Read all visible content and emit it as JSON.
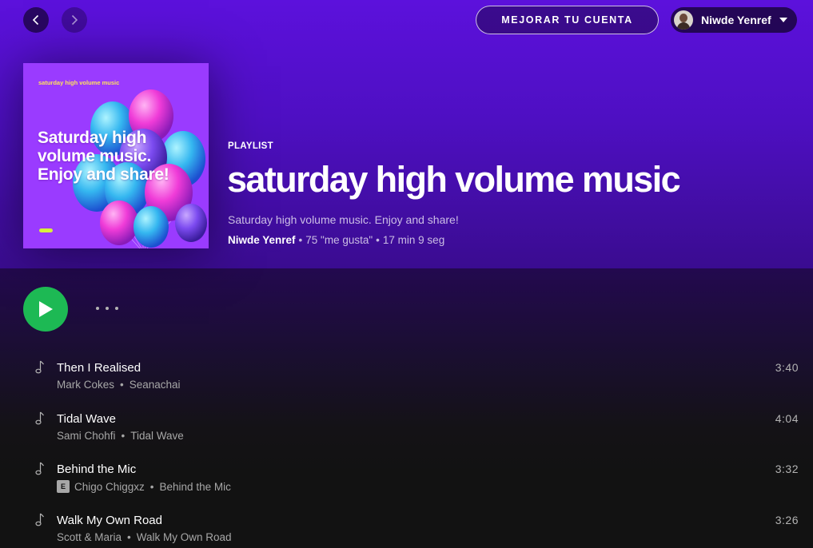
{
  "topbar": {
    "back_label": "Back",
    "forward_label": "Forward",
    "upgrade_label": "MEJORAR TU CUENTA",
    "user_name": "Niwde Yenref"
  },
  "cover": {
    "small_text": "saturday high volume music",
    "big_text": "Saturday high volume music. Enjoy and share!"
  },
  "playlist": {
    "kind": "PLAYLIST",
    "title": "saturday high volume music",
    "description": "Saturday high volume music. Enjoy and share!",
    "owner": "Niwde Yenref",
    "likes": "75 \"me gusta\"",
    "duration": "17 min 9 seg"
  },
  "tracks": [
    {
      "title": "Then I Realised",
      "artist": "Mark Cokes",
      "album": "Seanachai",
      "duration": "3:40",
      "explicit": false
    },
    {
      "title": "Tidal Wave",
      "artist": "Sami Chohfi",
      "album": "Tidal Wave",
      "duration": "4:04",
      "explicit": false
    },
    {
      "title": "Behind the Mic",
      "artist": "Chigo Chiggxz",
      "album": "Behind the Mic",
      "duration": "3:32",
      "explicit": true,
      "explicit_label": "E"
    },
    {
      "title": "Walk My Own Road",
      "artist": "Scott & Maria",
      "album": "Walk My Own Road",
      "duration": "3:26",
      "explicit": false
    }
  ],
  "colors": {
    "accent": "#1db954",
    "header": "#5a10d9",
    "background": "#121212"
  }
}
